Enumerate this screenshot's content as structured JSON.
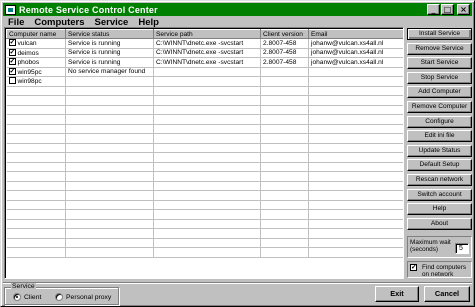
{
  "window": {
    "title": "Remote Service Control Center",
    "minimize": "_",
    "maximize": "□",
    "close": "×"
  },
  "menu": [
    "File",
    "Computers",
    "Service",
    "Help"
  ],
  "table": {
    "columns": [
      "Computer name",
      "Service status",
      "Service path",
      "Client version",
      "Email"
    ],
    "rows": [
      {
        "checked": true,
        "name": "vulcan",
        "status": "Service is running",
        "path": "C:\\WINNT\\dnetc.exe -svcstart",
        "version": "2.8007-458",
        "email": "johanw@vulcan.xs4all.nl"
      },
      {
        "checked": true,
        "name": "deimos",
        "status": "Service is running",
        "path": "C:\\WINNT\\dnetc.exe -svcstart",
        "version": "2.8007-458",
        "email": "johanw@vulcan.xs4all.nl"
      },
      {
        "checked": true,
        "name": "phobos",
        "status": "Service is running",
        "path": "C:\\WINNT\\dnetc.exe -svcstart",
        "version": "2.8007-458",
        "email": "johanw@vulcan.xs4all.nl"
      },
      {
        "checked": true,
        "name": "win95pc",
        "status": "No service manager found",
        "path": "",
        "version": "",
        "email": ""
      },
      {
        "checked": false,
        "name": "win98pc",
        "status": "",
        "path": "",
        "version": "",
        "email": ""
      }
    ]
  },
  "buttons": [
    "Install Service",
    "Remove Service",
    "Start Service",
    "Stop Service",
    "Add Computer",
    "Remove Computer",
    "Configure",
    "Edit ini file",
    "Update Status",
    "Default Setup",
    "Rescan network",
    "Switch account",
    "Help",
    "About"
  ],
  "max_wait": {
    "label": "Maximum wait (seconds)",
    "value": "5"
  },
  "find_computers": {
    "label": "Find computers on network",
    "checked": true
  },
  "service_group": {
    "legend": "Service",
    "options": [
      "Client",
      "Personal proxy"
    ],
    "selected": "Client"
  },
  "footer": {
    "exit_label": "Exit",
    "cancel_label": "Cancel"
  }
}
